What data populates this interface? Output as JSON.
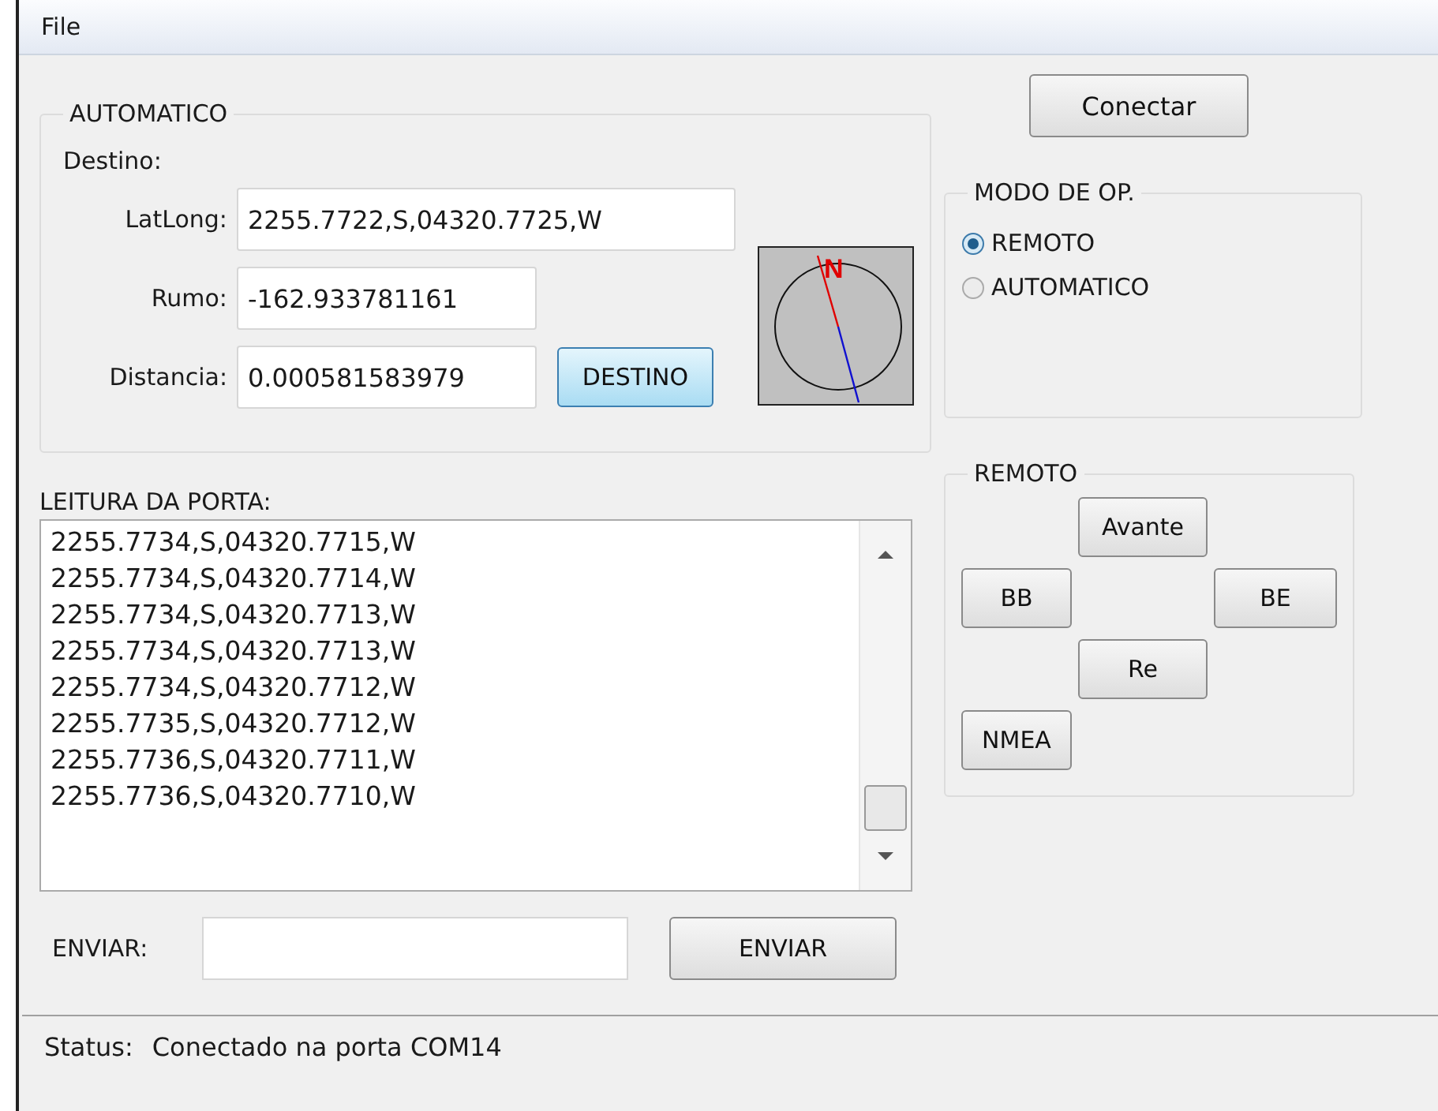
{
  "menu": [
    "File"
  ],
  "automatico": {
    "title": "AUTOMATICO",
    "destino_label": "Destino:",
    "fields": [
      {
        "label": "LatLong:",
        "value": "2255.7722,S,04320.7725,W"
      },
      {
        "label": "Rumo:",
        "value": "-162.933781161"
      },
      {
        "label": "Distancia:",
        "value": "0.000581583979"
      }
    ],
    "destino_button": "DESTINO",
    "compass": {
      "north_label": "N"
    }
  },
  "leitura": {
    "label": "LEITURA DA PORTA:",
    "lines": [
      "2255.7734,S,04320.7715,W",
      "2255.7734,S,04320.7714,W",
      "2255.7734,S,04320.7713,W",
      "2255.7734,S,04320.7713,W",
      "2255.7734,S,04320.7712,W",
      "2255.7735,S,04320.7712,W",
      "2255.7736,S,04320.7711,W",
      "2255.7736,S,04320.7710,W"
    ]
  },
  "enviar": {
    "label": "ENVIAR:",
    "button": "ENVIAR"
  },
  "conectar_button": "Conectar",
  "modo": {
    "title": "MODO DE OP.",
    "options": [
      {
        "label": "REMOTO",
        "selected": true
      },
      {
        "label": "AUTOMATICO",
        "selected": false
      }
    ]
  },
  "remoto": {
    "title": "REMOTO",
    "buttons": [
      "Avante",
      "BB",
      "BE",
      "Re",
      "NMEA"
    ]
  },
  "status": {
    "label": "Status:",
    "text": "Conectado na porta COM14"
  }
}
